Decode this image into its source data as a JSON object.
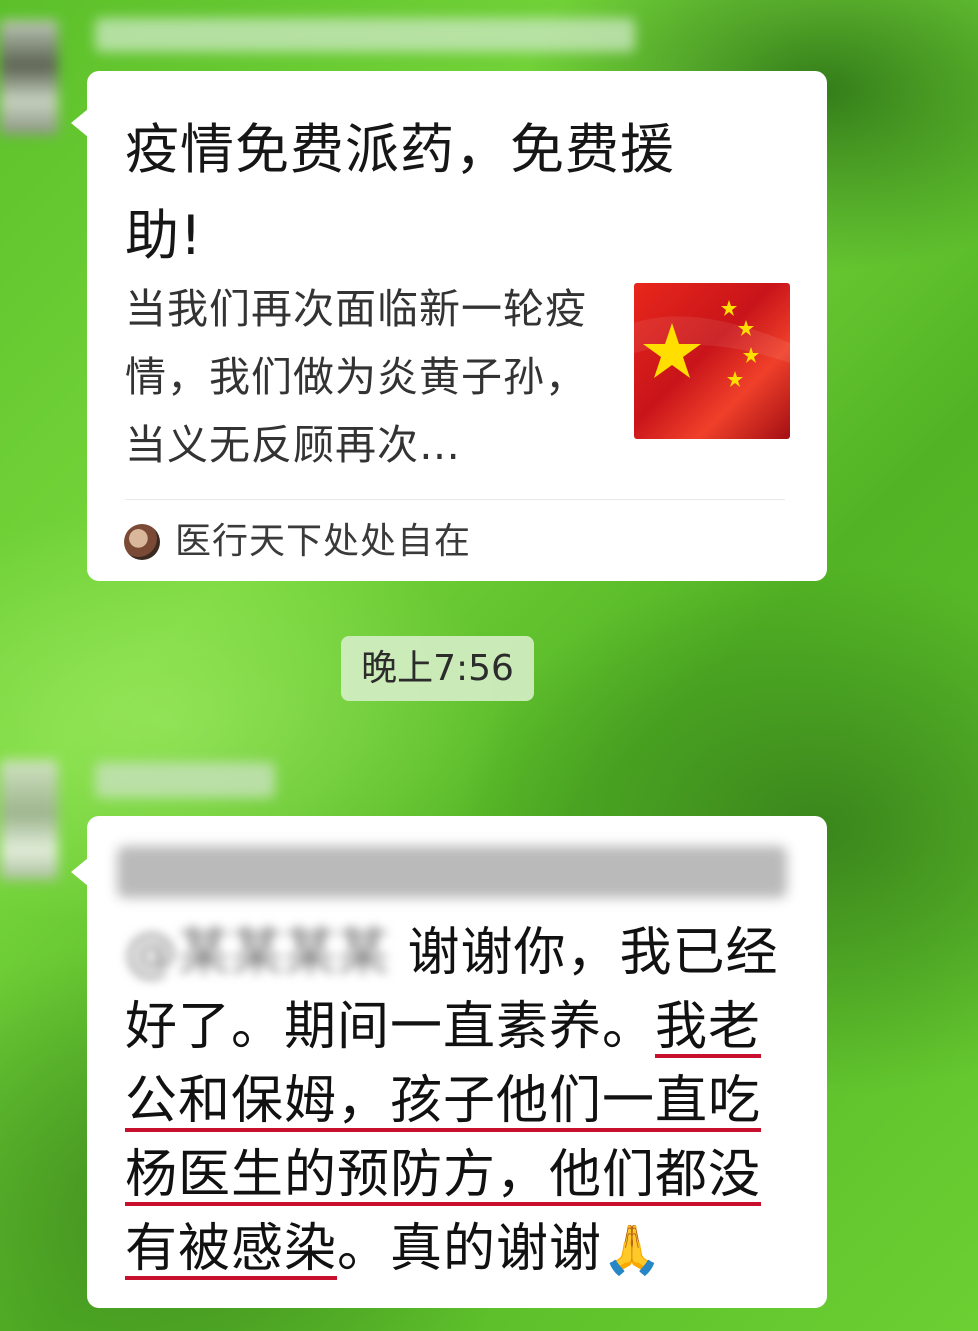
{
  "card_message": {
    "title": "疫情免费派药，免费援助!",
    "description": "当我们再次面临新一轮疫情，我们做为炎黄子孙，当义无反顾再次…",
    "thumbnail_icon": "flag-image",
    "source_name": "医行天下处处自在"
  },
  "timestamp": "晚上7:56",
  "text_message": {
    "blurred_prefix": "@某某某某",
    "part1": "谢谢你，我已经好了。期间一直素养。",
    "part2_underlined": "我老公和保姆，孩子他们一直吃杨医生的预防方，他们都没有被感染",
    "part3": "。真的谢谢",
    "emoji": "🙏"
  },
  "colors": {
    "background": "#5cc02a",
    "underline": "#c8102e",
    "bubble": "#ffffff"
  }
}
